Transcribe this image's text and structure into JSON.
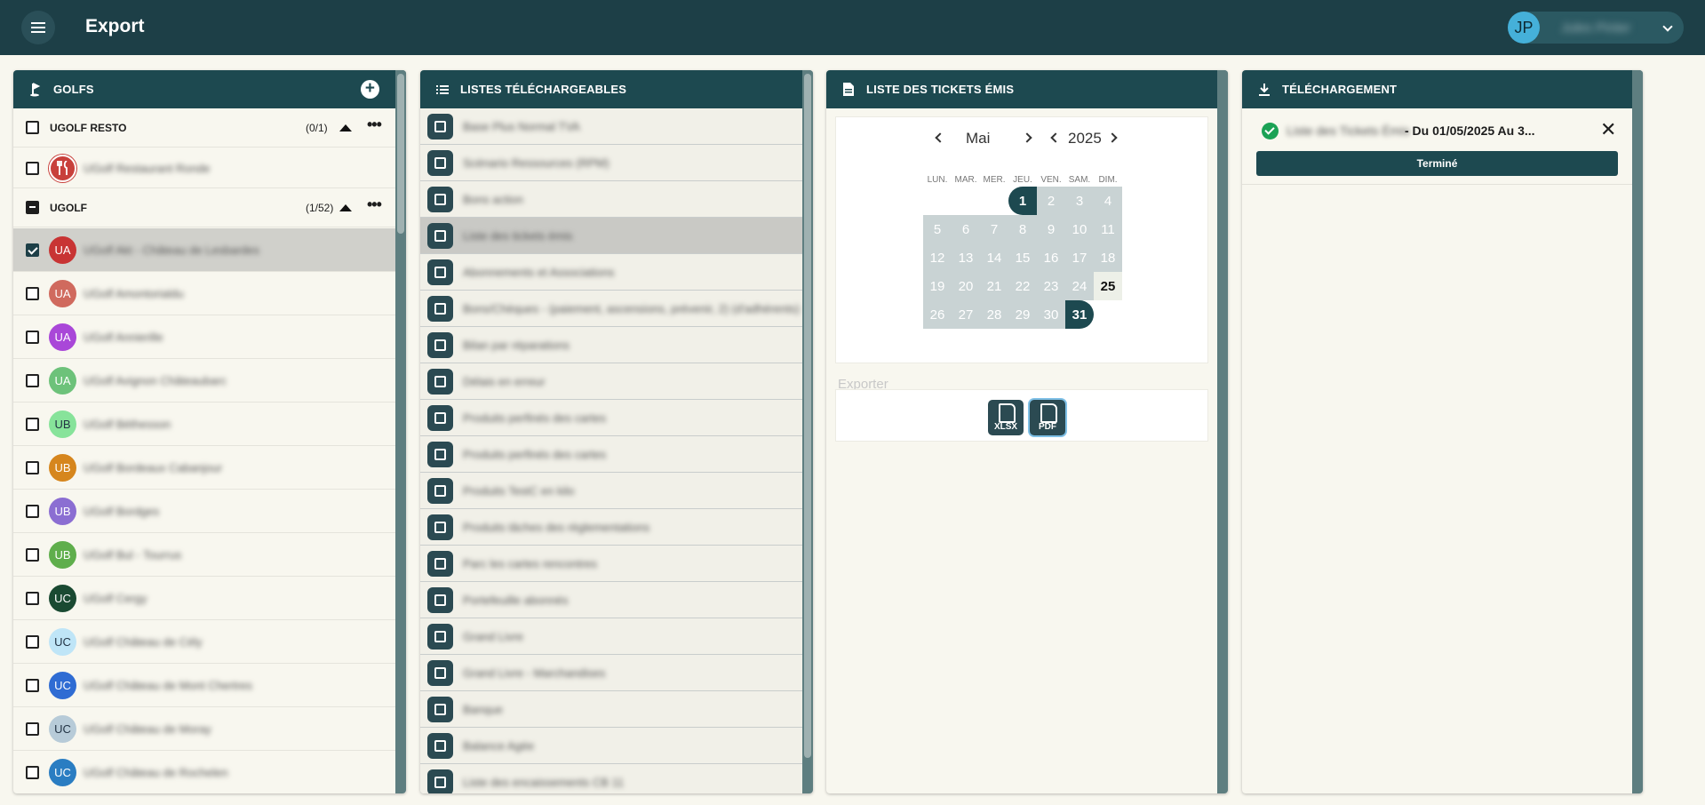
{
  "app": {
    "title": "Export"
  },
  "user": {
    "initials": "JP",
    "name": "Jules Pinter"
  },
  "golfs": {
    "title": "GOLFS",
    "groups": [
      {
        "name": "UGOLF RESTO",
        "count": "(0/1)",
        "items": [
          {
            "initials": "",
            "name": "UGolf Restaurant Ronde"
          }
        ]
      },
      {
        "name": "UGOLF",
        "count": "(1/52)",
        "items": [
          {
            "initials": "UA",
            "name": "UGolf Akt - Château de Lesbardes",
            "color": "#c83434",
            "checked": true
          },
          {
            "initials": "UA",
            "name": "UGolf Amontorialdu",
            "color": "#d06a5e"
          },
          {
            "initials": "UA",
            "name": "UGolf Annierille",
            "color": "#a947d8"
          },
          {
            "initials": "UA",
            "name": "UGolf Avignon Châteaubarc",
            "color": "#6dc27a"
          },
          {
            "initials": "UB",
            "name": "UGolf Béthesson",
            "color": "#87e39a"
          },
          {
            "initials": "UB",
            "name": "UGolf Bordeaux Cabanjour",
            "color": "#d6861d"
          },
          {
            "initials": "UB",
            "name": "UGolf Bordges",
            "color": "#8b6ed2"
          },
          {
            "initials": "UB",
            "name": "UGolf Bul - Tourrus",
            "color": "#5fae4c"
          },
          {
            "initials": "UC",
            "name": "UGolf Cergy",
            "color": "#1a4a32"
          },
          {
            "initials": "UC",
            "name": "UGolf Château de Cély",
            "color": "#bfe5f7"
          },
          {
            "initials": "UC",
            "name": "UGolf Château de Mont Chertres",
            "color": "#2f6cd3"
          },
          {
            "initials": "UC",
            "name": "UGolf Château de Moray",
            "color": "#b7cbd8"
          },
          {
            "initials": "UC",
            "name": "UGolf Château de Rochelen",
            "color": "#2a7dc2"
          }
        ]
      }
    ]
  },
  "lists": {
    "title": "LISTES TÉLÉCHARGEABLES",
    "items": [
      "Base Plus Normal TVA",
      "Scénario Ressources (RPM)",
      "Bons action",
      "Liste des tickets émis",
      "Abonnements et Associations",
      "Bons/Chèques - (paiement, ascensions, prévenir, 2) (d'adhérents)",
      "Bilan par réparations",
      "Délais en erreur",
      "Produits perfinés des cartes",
      "Produits perfinés des cartes",
      "Produits TestC en kilo",
      "Produits tâches des règlementations",
      "Parc les cartes rencontres",
      "Portefeuille abonnés",
      "Grand Livre",
      "Grand Livre - Marchandises",
      "Banque",
      "Balance Agée",
      "Liste des encaissements CB 11"
    ]
  },
  "tickets": {
    "title": "LISTE DES TICKETS ÉMIS",
    "month": "Mai",
    "year": "2025",
    "weekdays": [
      "LUN.",
      "MAR.",
      "MER.",
      "JEU.",
      "VEN.",
      "SAM.",
      "DIM."
    ],
    "days": [
      "1",
      "2",
      "3",
      "4",
      "5",
      "6",
      "7",
      "8",
      "9",
      "10",
      "11",
      "12",
      "13",
      "14",
      "15",
      "16",
      "17",
      "18",
      "19",
      "20",
      "21",
      "22",
      "23",
      "24",
      "25",
      "26",
      "27",
      "28",
      "29",
      "30",
      "31"
    ],
    "export_label": "Exporter",
    "export_buttons": [
      "XLSX",
      "PDF"
    ]
  },
  "download": {
    "title": "TÉLÉCHARGEMENT",
    "file_name": "Liste des Tickets Émis",
    "range": "- Du 01/05/2025 Au 3...",
    "status": "Terminé"
  }
}
